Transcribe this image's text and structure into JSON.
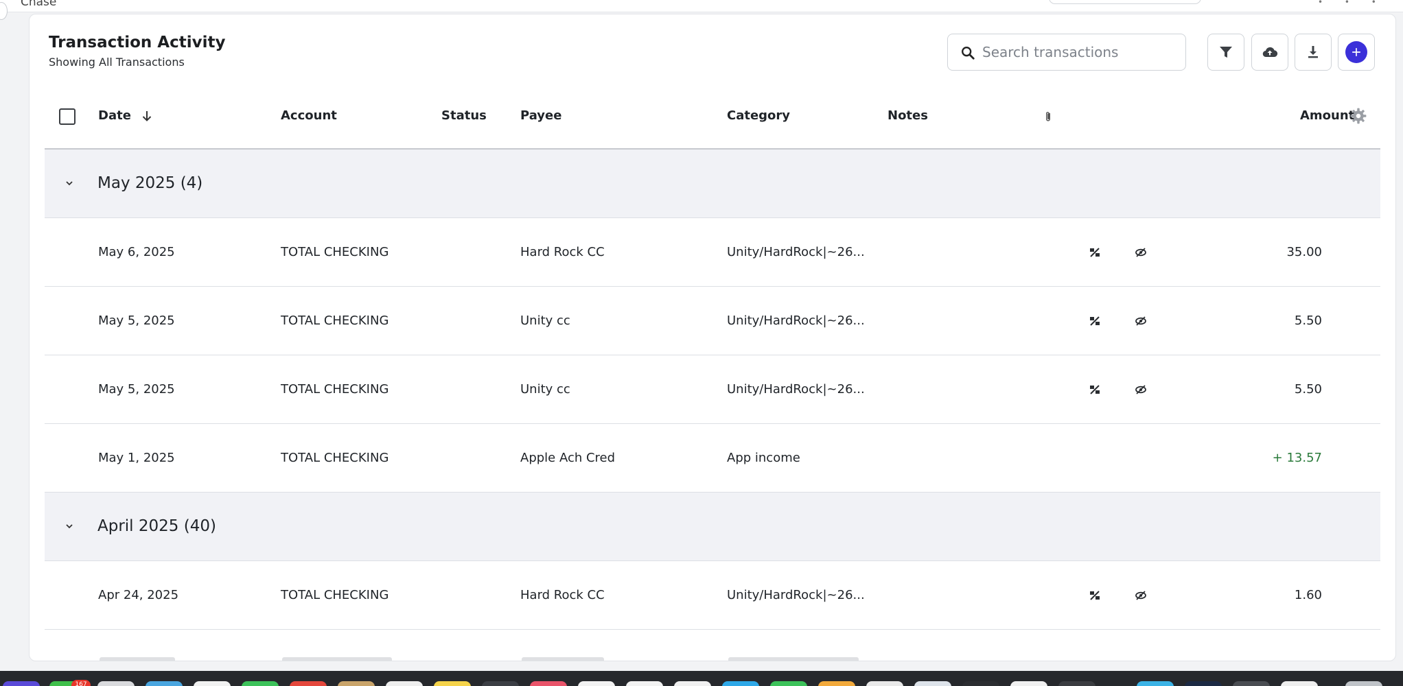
{
  "window": {
    "title": "Chase"
  },
  "header": {
    "title": "Transaction Activity",
    "subtitle": "Showing All Transactions"
  },
  "search": {
    "placeholder": "Search transactions",
    "value": ""
  },
  "toolbar": {
    "filter_icon": "filter-icon",
    "upload_icon": "cloud-upload-icon",
    "download_icon": "download-icon",
    "add_icon": "plus-icon"
  },
  "columns": {
    "date": "Date",
    "account": "Account",
    "status": "Status",
    "payee": "Payee",
    "category": "Category",
    "notes": "Notes",
    "amount": "Amount"
  },
  "groups": [
    {
      "label": "May 2025 (4)",
      "rows": [
        {
          "date": "May 6, 2025",
          "account": "TOTAL CHECKING",
          "payee": "Hard Rock CC",
          "category": "Unity/HardRock|~26...",
          "amount": "35.00",
          "icons": true
        },
        {
          "date": "May 5, 2025",
          "account": "TOTAL CHECKING",
          "payee": "Unity cc",
          "category": "Unity/HardRock|~26...",
          "amount": "5.50",
          "icons": true
        },
        {
          "date": "May 5, 2025",
          "account": "TOTAL CHECKING",
          "payee": "Unity cc",
          "category": "Unity/HardRock|~26...",
          "amount": "5.50",
          "icons": true
        },
        {
          "date": "May 1, 2025",
          "account": "TOTAL CHECKING",
          "payee": "Apple Ach Cred",
          "category": "App income",
          "amount": "+ 13.57",
          "icons": false
        }
      ]
    },
    {
      "label": "April 2025 (40)",
      "rows": [
        {
          "date": "Apr 24, 2025",
          "account": "TOTAL CHECKING",
          "payee": "Hard Rock CC",
          "category": "Unity/HardRock|~26...",
          "amount": "1.60",
          "icons": true
        }
      ]
    }
  ],
  "dock": {
    "badge": "167"
  },
  "colors": {
    "accent": "#3b30d9",
    "positive": "#2a7a3a",
    "group_bg": "#f1f2f6"
  }
}
